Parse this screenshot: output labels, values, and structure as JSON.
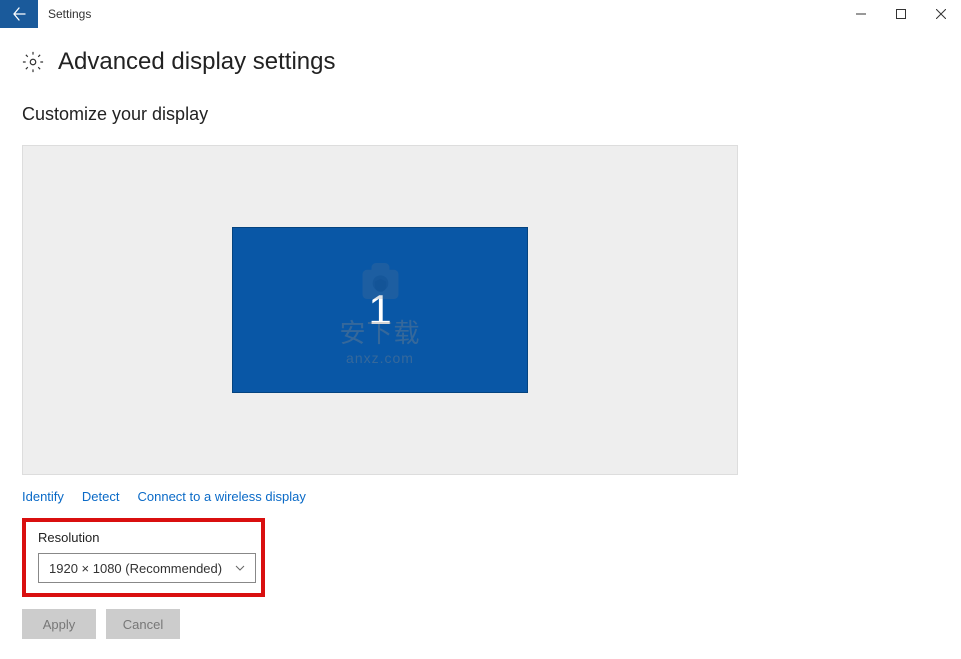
{
  "titlebar": {
    "appName": "Settings"
  },
  "page": {
    "title": "Advanced display settings",
    "subtitle": "Customize your display",
    "monitor": {
      "number": "1"
    }
  },
  "links": {
    "identify": "Identify",
    "detect": "Detect",
    "connect": "Connect to a wireless display"
  },
  "resolution": {
    "label": "Resolution",
    "selected": "1920 × 1080 (Recommended)"
  },
  "buttons": {
    "apply": "Apply",
    "cancel": "Cancel"
  },
  "watermark": {
    "main": "安下载",
    "sub": "anxz.com"
  }
}
